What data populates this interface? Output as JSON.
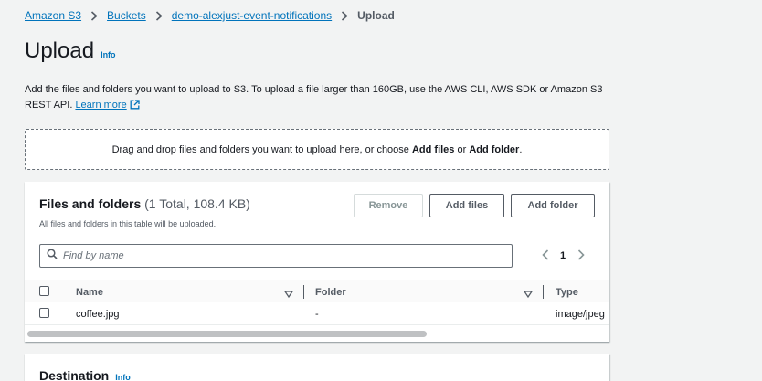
{
  "breadcrumb": {
    "items": [
      "Amazon S3",
      "Buckets",
      "demo-alexjust-event-notifications"
    ],
    "current": "Upload"
  },
  "page": {
    "title": "Upload",
    "info": "Info",
    "description": "Add the files and folders you want to upload to S3. To upload a file larger than 160GB, use the AWS CLI, AWS SDK or Amazon S3 REST API.",
    "learn_more": "Learn more"
  },
  "dropzone": {
    "text_before": "Drag and drop files and folders you want to upload here, or choose ",
    "add_files": "Add files",
    "text_or": " or ",
    "add_folder": "Add folder",
    "text_end": "."
  },
  "files_panel": {
    "title": "Files and folders",
    "count": "(1 Total, 108.4 KB)",
    "subtitle": "All files and folders in this table will be uploaded.",
    "remove_label": "Remove",
    "add_files_label": "Add files",
    "add_folder_label": "Add folder",
    "search_placeholder": "Find by name",
    "page_number": "1",
    "columns": [
      "Name",
      "Folder",
      "Type"
    ],
    "rows": [
      {
        "name": "coffee.jpg",
        "folder": "-",
        "type": "image/jpeg"
      }
    ]
  },
  "destination_panel": {
    "title": "Destination",
    "info": "Info"
  },
  "colors": {
    "link": "#0073bb",
    "text": "#16191f",
    "secondary_text": "#545b64",
    "background": "#f2f3f3"
  }
}
